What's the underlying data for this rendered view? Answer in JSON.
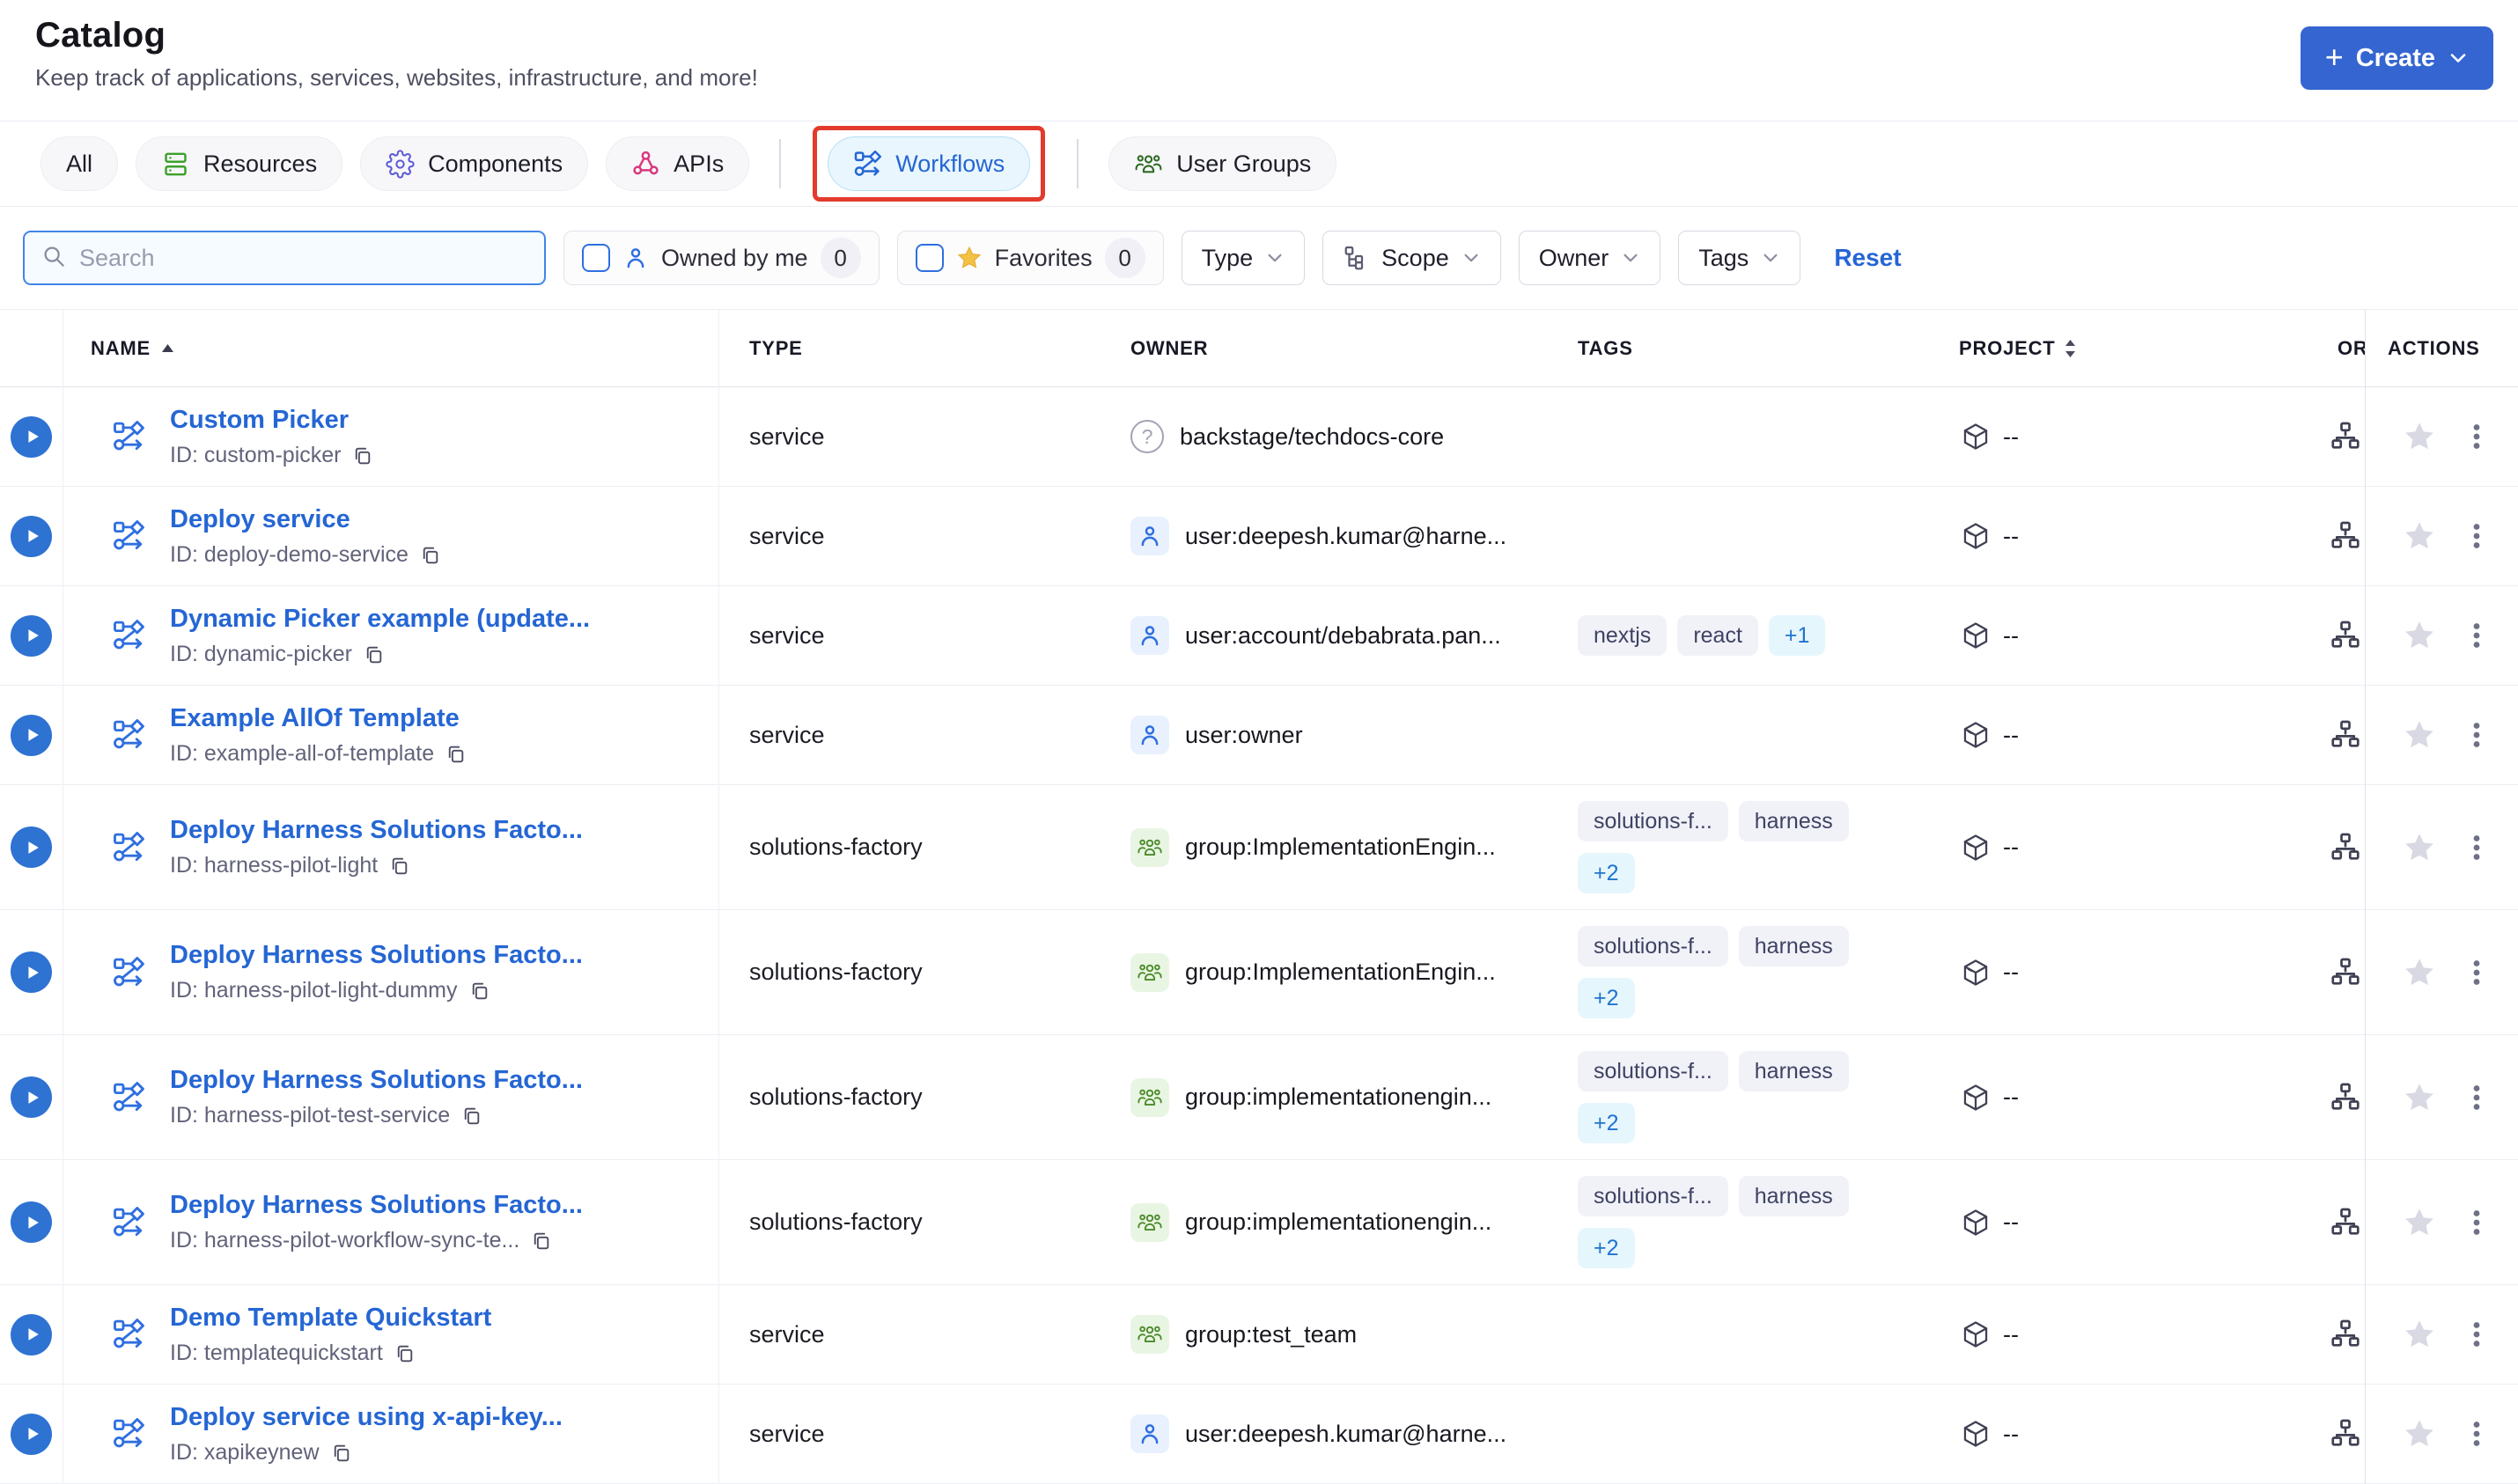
{
  "colors": {
    "accent_blue": "#2e72d2",
    "link_blue": "#2566d4",
    "create_button_bg": "#3565d1",
    "annotation_red": "#e23b2e",
    "active_tab_bg": "#e9f6fe",
    "tag_bg": "#f1f1f8",
    "tag_more_bg": "#e6f6fd",
    "group_green": "#4b8b2a"
  },
  "page": {
    "title": "Catalog",
    "subtitle": "Keep track of applications, services, websites, infrastructure, and more!",
    "create_label": "Create"
  },
  "tabs": {
    "items": [
      {
        "label": "All",
        "icon": null,
        "active": false,
        "annotated": false,
        "divider_before": false
      },
      {
        "label": "Resources",
        "icon": "resources",
        "active": false,
        "annotated": false,
        "divider_before": false
      },
      {
        "label": "Components",
        "icon": "components",
        "active": false,
        "annotated": false,
        "divider_before": false
      },
      {
        "label": "APIs",
        "icon": "apis",
        "active": false,
        "annotated": false,
        "divider_before": false
      },
      {
        "label": "Workflows",
        "icon": "workflows",
        "active": true,
        "annotated": true,
        "divider_before": true
      },
      {
        "label": "User Groups",
        "icon": "usergroups",
        "active": false,
        "annotated": false,
        "divider_before": true
      }
    ]
  },
  "filters": {
    "search_placeholder": "Search",
    "owned_by_me": {
      "label": "Owned by me",
      "count": "0"
    },
    "favorites": {
      "label": "Favorites",
      "count": "0"
    },
    "dropdowns": [
      {
        "label": "Type",
        "icon": null
      },
      {
        "label": "Scope",
        "icon": "scope"
      },
      {
        "label": "Owner",
        "icon": null
      },
      {
        "label": "Tags",
        "icon": null
      }
    ],
    "reset_label": "Reset"
  },
  "table": {
    "columns": {
      "name": "NAME",
      "type": "TYPE",
      "owner": "OWNER",
      "tags": "TAGS",
      "project": "PROJECT",
      "org": "OR",
      "actions": "ACTIONS"
    },
    "rows": [
      {
        "name": "Custom Picker",
        "id_label": "ID: custom-picker",
        "type": "service",
        "owner": {
          "kind": "unknown",
          "label": "backstage/techdocs-core"
        },
        "tags": [],
        "tags_more": "",
        "project": "--"
      },
      {
        "name": "Deploy service",
        "id_label": "ID: deploy-demo-service",
        "type": "service",
        "owner": {
          "kind": "user",
          "label": "user:deepesh.kumar@harne..."
        },
        "tags": [],
        "tags_more": "",
        "project": "--"
      },
      {
        "name": "Dynamic Picker example (update...",
        "id_label": "ID: dynamic-picker",
        "type": "service",
        "owner": {
          "kind": "user",
          "label": "user:account/debabrata.pan..."
        },
        "tags": [
          "nextjs",
          "react"
        ],
        "tags_more": "+1",
        "project": "--"
      },
      {
        "name": "Example AllOf Template",
        "id_label": "ID: example-all-of-template",
        "type": "service",
        "owner": {
          "kind": "user",
          "label": "user:owner"
        },
        "tags": [],
        "tags_more": "",
        "project": "--"
      },
      {
        "name": "Deploy Harness Solutions Facto...",
        "id_label": "ID: harness-pilot-light",
        "type": "solutions-factory",
        "owner": {
          "kind": "group",
          "label": "group:ImplementationEngin..."
        },
        "tags": [
          "solutions-f...",
          "harness"
        ],
        "tags_more": "+2",
        "project": "--"
      },
      {
        "name": "Deploy Harness Solutions Facto...",
        "id_label": "ID: harness-pilot-light-dummy",
        "type": "solutions-factory",
        "owner": {
          "kind": "group",
          "label": "group:ImplementationEngin..."
        },
        "tags": [
          "solutions-f...",
          "harness"
        ],
        "tags_more": "+2",
        "project": "--"
      },
      {
        "name": "Deploy Harness Solutions Facto...",
        "id_label": "ID: harness-pilot-test-service",
        "type": "solutions-factory",
        "owner": {
          "kind": "group",
          "label": "group:implementationengin..."
        },
        "tags": [
          "solutions-f...",
          "harness"
        ],
        "tags_more": "+2",
        "project": "--"
      },
      {
        "name": "Deploy Harness Solutions Facto...",
        "id_label": "ID: harness-pilot-workflow-sync-te...",
        "type": "solutions-factory",
        "owner": {
          "kind": "group",
          "label": "group:implementationengin..."
        },
        "tags": [
          "solutions-f...",
          "harness"
        ],
        "tags_more": "+2",
        "project": "--"
      },
      {
        "name": "Demo Template Quickstart",
        "id_label": "ID: templatequickstart",
        "type": "service",
        "owner": {
          "kind": "group",
          "label": "group:test_team"
        },
        "tags": [],
        "tags_more": "",
        "project": "--"
      },
      {
        "name": "Deploy service using x-api-key...",
        "id_label": "ID: xapikeynew",
        "type": "service",
        "owner": {
          "kind": "user",
          "label": "user:deepesh.kumar@harne..."
        },
        "tags": [],
        "tags_more": "",
        "project": "--"
      }
    ]
  }
}
